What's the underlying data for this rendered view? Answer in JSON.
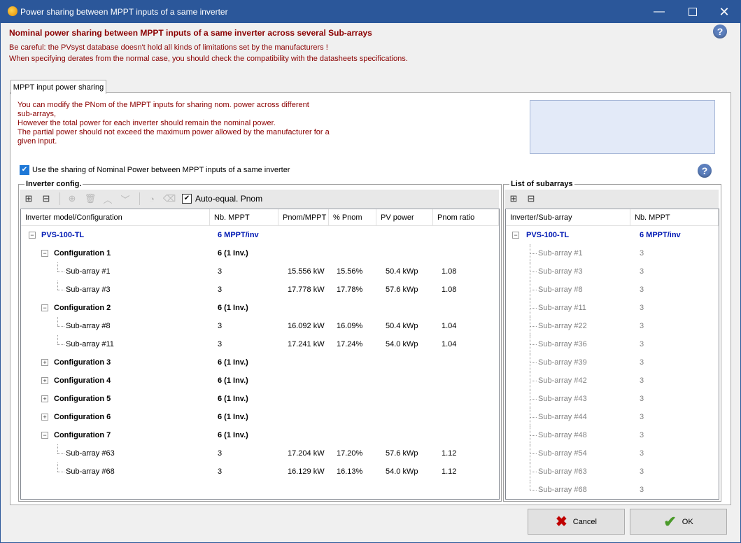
{
  "window": {
    "title": "Power sharing between MPPT inputs of a same inverter"
  },
  "header": {
    "heading": "Nominal power sharing between MPPT inputs of a same inverter across several Sub-arrays",
    "warning1": "Be careful: the PVsyst database doesn't hold all kinds of limitations set by the manufacturers !",
    "warning2": "When specifying derates from the normal case, you should check the compatibility with the datasheets specifications."
  },
  "tab": {
    "label": "MPPT input power sharing"
  },
  "info": [
    "You can modify the PNom of the MPPT inputs for sharing nom. power across different",
    "sub-arrays,",
    "However the total power for each inverter should remain the nominal power.",
    "The partial power should not exceed the maximum power allowed by the manufacturer for a",
    "given input."
  ],
  "use_sharing": {
    "label": "Use the sharing of Nominal Power between MPPT inputs of a same inverter",
    "checked": true
  },
  "inverter_config": {
    "legend": "Inverter config.",
    "auto_equal_label": "Auto-equal. Pnom",
    "columns": [
      "Inverter model/Configuration",
      "Nb. MPPT",
      "Pnom/MPPT",
      "% Pnom",
      "PV power",
      "Pnom ratio"
    ],
    "rows": [
      {
        "level": 0,
        "exp": "−",
        "name": "PVS-100-TL",
        "nb": "6 MPPT/inv",
        "pnom": "",
        "pct": "",
        "pv": "",
        "ratio": ""
      },
      {
        "level": 1,
        "exp": "−",
        "name": "Configuration 1",
        "nb": "6 (1 Inv.)",
        "pnom": "",
        "pct": "",
        "pv": "",
        "ratio": ""
      },
      {
        "level": 2,
        "exp": "",
        "name": "Sub-array #1",
        "nb": "3",
        "pnom": "15.556 kW",
        "pct": "15.56%",
        "pv": "50.4 kWp",
        "ratio": "1.08"
      },
      {
        "level": 2,
        "exp": "",
        "name": "Sub-array #3",
        "nb": "3",
        "pnom": "17.778 kW",
        "pct": "17.78%",
        "pv": "57.6 kWp",
        "ratio": "1.08"
      },
      {
        "level": 1,
        "exp": "−",
        "name": "Configuration 2",
        "nb": "6 (1 Inv.)",
        "pnom": "",
        "pct": "",
        "pv": "",
        "ratio": ""
      },
      {
        "level": 2,
        "exp": "",
        "name": "Sub-array #8",
        "nb": "3",
        "pnom": "16.092 kW",
        "pct": "16.09%",
        "pv": "50.4 kWp",
        "ratio": "1.04"
      },
      {
        "level": 2,
        "exp": "",
        "name": "Sub-array #11",
        "nb": "3",
        "pnom": "17.241 kW",
        "pct": "17.24%",
        "pv": "54.0 kWp",
        "ratio": "1.04"
      },
      {
        "level": 1,
        "exp": "+",
        "name": "Configuration 3",
        "nb": "6 (1 Inv.)",
        "pnom": "",
        "pct": "",
        "pv": "",
        "ratio": ""
      },
      {
        "level": 1,
        "exp": "+",
        "name": "Configuration 4",
        "nb": "6 (1 Inv.)",
        "pnom": "",
        "pct": "",
        "pv": "",
        "ratio": ""
      },
      {
        "level": 1,
        "exp": "+",
        "name": "Configuration 5",
        "nb": "6 (1 Inv.)",
        "pnom": "",
        "pct": "",
        "pv": "",
        "ratio": ""
      },
      {
        "level": 1,
        "exp": "+",
        "name": "Configuration 6",
        "nb": "6 (1 Inv.)",
        "pnom": "",
        "pct": "",
        "pv": "",
        "ratio": ""
      },
      {
        "level": 1,
        "exp": "−",
        "name": "Configuration 7",
        "nb": "6 (1 Inv.)",
        "pnom": "",
        "pct": "",
        "pv": "",
        "ratio": ""
      },
      {
        "level": 2,
        "exp": "",
        "name": "Sub-array #63",
        "nb": "3",
        "pnom": "17.204 kW",
        "pct": "17.20%",
        "pv": "57.6 kWp",
        "ratio": "1.12"
      },
      {
        "level": 2,
        "exp": "",
        "name": "Sub-array #68",
        "nb": "3",
        "pnom": "16.129 kW",
        "pct": "16.13%",
        "pv": "54.0 kWp",
        "ratio": "1.12"
      }
    ]
  },
  "subarrays": {
    "legend": "List of subarrays",
    "columns": [
      "Inverter/Sub-array",
      "Nb. MPPT"
    ],
    "rows": [
      {
        "level": 0,
        "name": "PVS-100-TL",
        "nb": "6 MPPT/inv"
      },
      {
        "level": 1,
        "name": "Sub-array #1",
        "nb": "3"
      },
      {
        "level": 1,
        "name": "Sub-array #3",
        "nb": "3"
      },
      {
        "level": 1,
        "name": "Sub-array #8",
        "nb": "3"
      },
      {
        "level": 1,
        "name": "Sub-array #11",
        "nb": "3"
      },
      {
        "level": 1,
        "name": "Sub-array #22",
        "nb": "3"
      },
      {
        "level": 1,
        "name": "Sub-array #36",
        "nb": "3"
      },
      {
        "level": 1,
        "name": "Sub-array #39",
        "nb": "3"
      },
      {
        "level": 1,
        "name": "Sub-array #42",
        "nb": "3"
      },
      {
        "level": 1,
        "name": "Sub-array #43",
        "nb": "3"
      },
      {
        "level": 1,
        "name": "Sub-array #44",
        "nb": "3"
      },
      {
        "level": 1,
        "name": "Sub-array #48",
        "nb": "3"
      },
      {
        "level": 1,
        "name": "Sub-array #54",
        "nb": "3"
      },
      {
        "level": 1,
        "name": "Sub-array #63",
        "nb": "3"
      },
      {
        "level": 1,
        "name": "Sub-array #68",
        "nb": "3"
      }
    ]
  },
  "buttons": {
    "cancel": "Cancel",
    "ok": "OK"
  },
  "colors": {
    "titlebar": "#2b579a",
    "warning_text": "#8b0000",
    "inverter_text": "#0019b4"
  }
}
